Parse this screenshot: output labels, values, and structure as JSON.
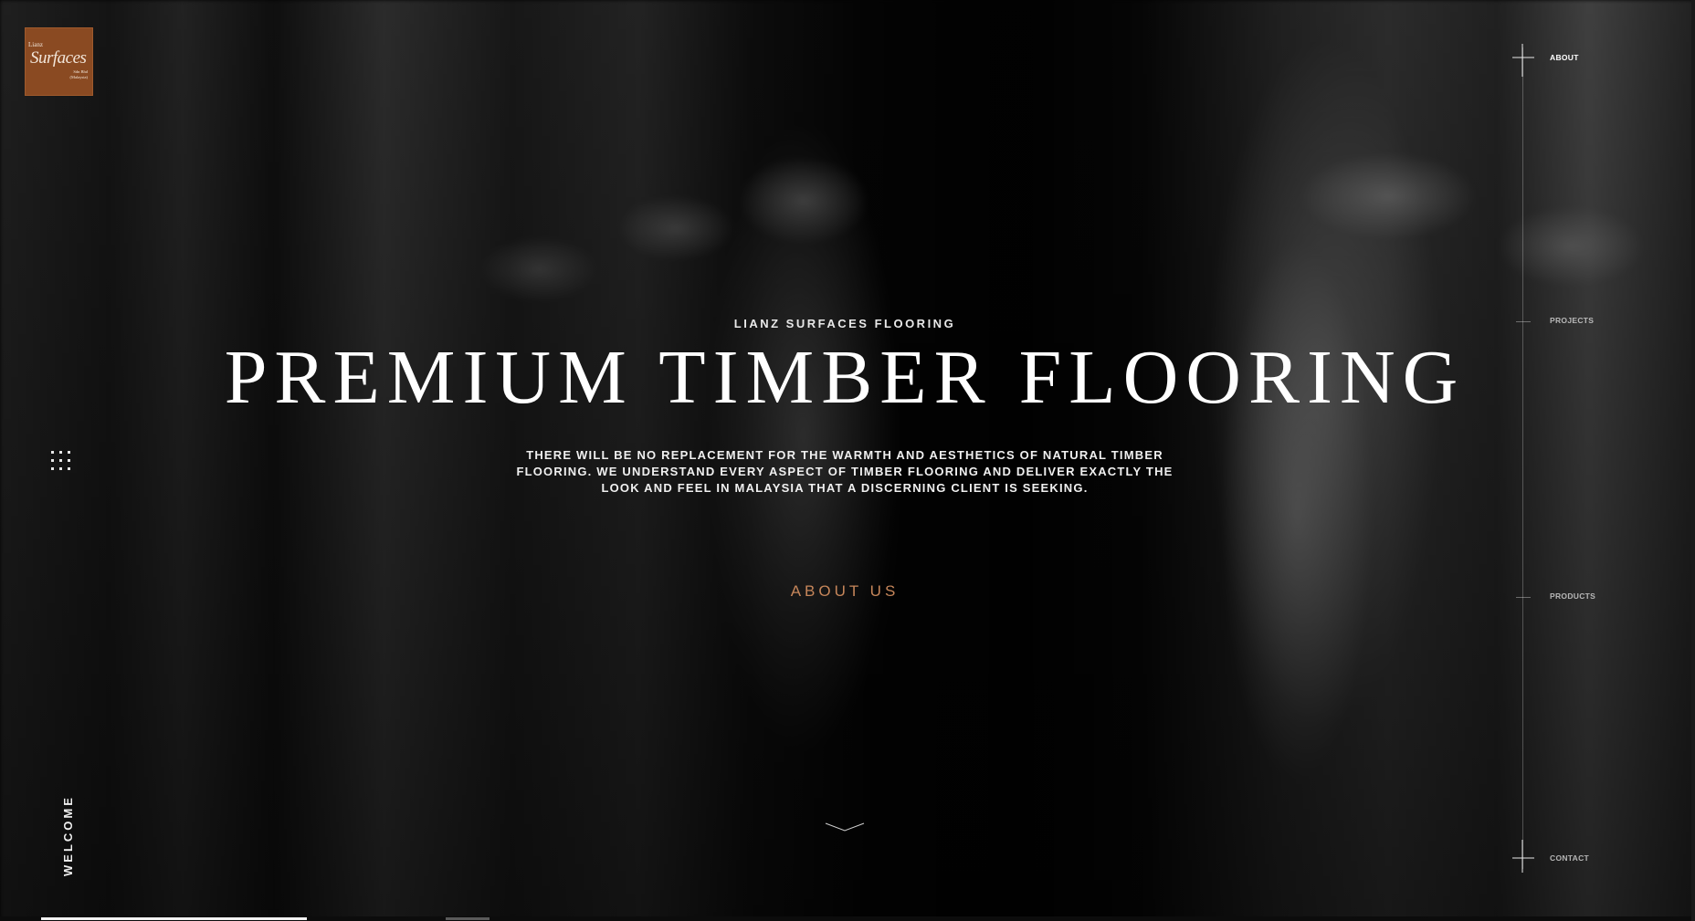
{
  "brand": {
    "logo_line1": "Lianz",
    "logo_line2": "Surfaces",
    "logo_line3": "Sdn Bhd",
    "logo_line4": "(Malaysia)"
  },
  "side": {
    "section_label": "WELCOME",
    "menu_icon": "grid-dots-icon"
  },
  "hero": {
    "eyebrow": "LIANZ SURFACES FLOORING",
    "headline": "PREMIUM TIMBER FLOORING",
    "description": "THERE WILL BE NO REPLACEMENT FOR THE WARMTH AND AESTHETICS OF NATURAL TIMBER FLOORING. WE UNDERSTAND EVERY ASPECT OF TIMBER FLOORING AND DELIVER EXACTLY THE LOOK AND FEEL IN MALAYSIA THAT A DISCERNING CLIENT IS SEEKING.",
    "cta_label": "ABOUT US",
    "scroll_icon": "chevron-down-icon",
    "accent_color": "#c6865a"
  },
  "nav": {
    "items": [
      {
        "label": "ABOUT",
        "active": true
      },
      {
        "label": "PROJECTS",
        "active": false
      },
      {
        "label": "PRODUCTS",
        "active": false
      },
      {
        "label": "CONTACT",
        "active": false
      }
    ]
  },
  "progress": {
    "fraction": 0.157
  }
}
